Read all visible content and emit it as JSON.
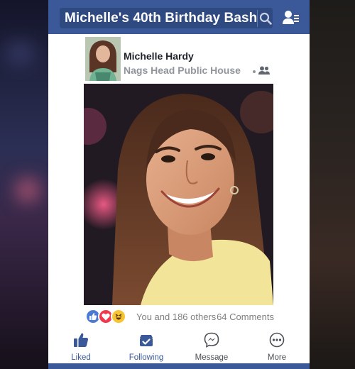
{
  "header": {
    "title": "Michelle's 40th Birthday Bash",
    "search_icon": "search-icon",
    "friends_icon": "friend-requests-icon"
  },
  "post": {
    "author_name": "Michelle Hardy",
    "location": "Nags Head Public House",
    "privacy_icon": "friends-icon"
  },
  "engagement": {
    "reaction_icons": [
      "like",
      "love",
      "haha"
    ],
    "others_text": "You and 186 others",
    "comments_text": "64 Comments"
  },
  "actions": [
    {
      "label": "Liked",
      "icon": "thumbs-up-icon",
      "active": true
    },
    {
      "label": "Following",
      "icon": "following-icon",
      "active": true
    },
    {
      "label": "Message",
      "icon": "messenger-icon",
      "active": false
    },
    {
      "label": "More",
      "icon": "more-icon",
      "active": false
    }
  ],
  "colors": {
    "brand": "#3b5998",
    "like": "#4b7bd4",
    "love": "#f0384f",
    "haha": "#f7c531"
  }
}
